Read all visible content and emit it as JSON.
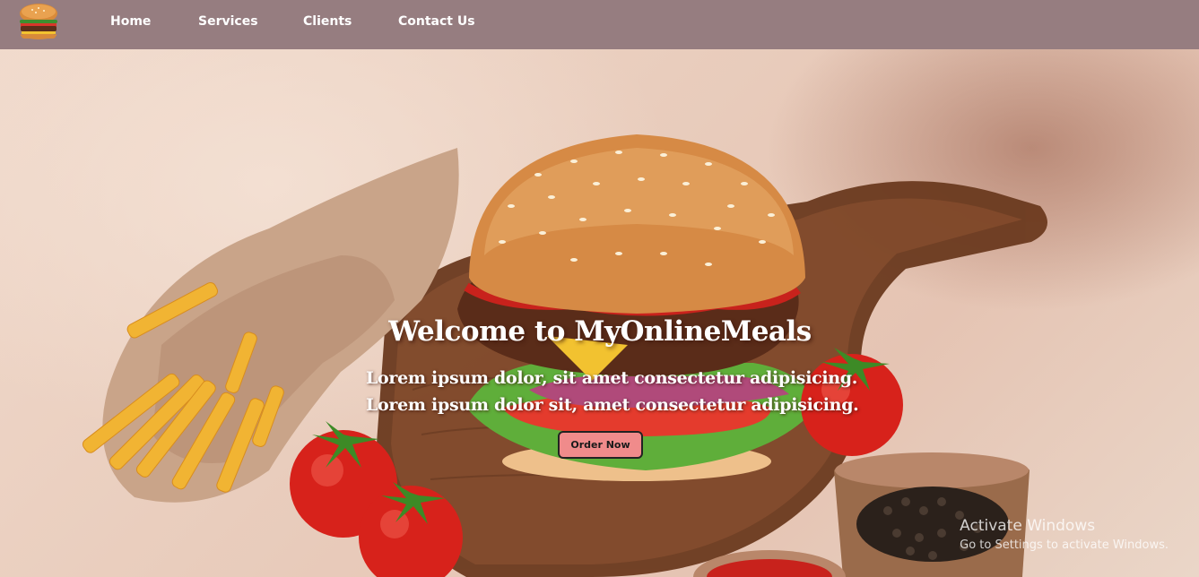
{
  "nav": {
    "logo_icon": "burger-icon",
    "links": [
      {
        "label": "Home"
      },
      {
        "label": "Services"
      },
      {
        "label": "Clients"
      },
      {
        "label": "Contact Us"
      }
    ]
  },
  "hero": {
    "title": "Welcome to MyOnlineMeals",
    "subtitle_line1": "Lorem ipsum dolor, sit amet consectetur adipisicing.",
    "subtitle_line2": "Lorem ipsum dolor sit, amet consectetur adipisicing.",
    "cta_label": "Order Now",
    "cta_color": "#f08b8b",
    "background_image": "burger-fries-tomatoes-photo"
  },
  "watermark": {
    "line1": "Activate Windows",
    "line2": "Go to Settings to activate Windows."
  },
  "colors": {
    "navbar": "#967d80",
    "nav_text": "#ffffff"
  }
}
